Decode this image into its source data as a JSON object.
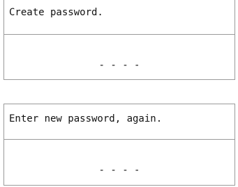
{
  "screens": [
    {
      "prompt": "Create password.",
      "pin_placeholder": "- - - -"
    },
    {
      "prompt": "Enter new password, again.",
      "pin_placeholder": "- - - -"
    }
  ]
}
